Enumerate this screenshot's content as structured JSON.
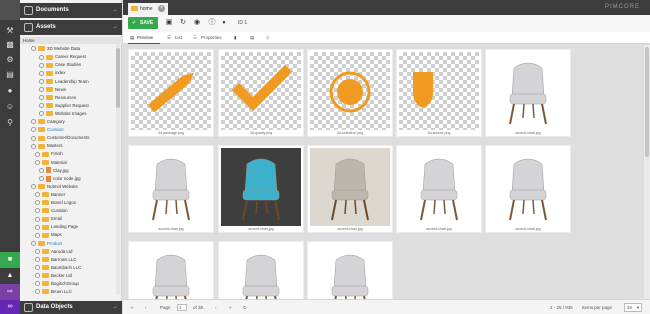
{
  "app": {
    "brand": "PIMCORE"
  },
  "panels": {
    "documents": "Documents",
    "assets": "Assets",
    "data_objects": "Data Objects"
  },
  "tree": {
    "items": [
      {
        "label": "Home",
        "kind": "home"
      },
      {
        "label": "3D Website Data",
        "kind": "folder"
      },
      {
        "label": "Career Request",
        "kind": "folder"
      },
      {
        "label": "Case Studies",
        "kind": "folder"
      },
      {
        "label": "index",
        "kind": "folder"
      },
      {
        "label": "Leadership Team",
        "kind": "folder"
      },
      {
        "label": "News",
        "kind": "folder"
      },
      {
        "label": "Resources",
        "kind": "folder"
      },
      {
        "label": "Supplier Request",
        "kind": "folder"
      },
      {
        "label": "Website Images",
        "kind": "folder"
      },
      {
        "label": "Category",
        "kind": "folder"
      },
      {
        "label": "Curation",
        "kind": "folder-link"
      },
      {
        "label": "Customer/Documents",
        "kind": "folder"
      },
      {
        "label": "Masters",
        "kind": "folder"
      },
      {
        "label": "Finish",
        "kind": "folder"
      },
      {
        "label": "Material",
        "kind": "folder"
      },
      {
        "label": "Clay.jpg",
        "kind": "image"
      },
      {
        "label": "color node.jpg",
        "kind": "image"
      },
      {
        "label": "Nutmol Website",
        "kind": "folder"
      },
      {
        "label": "Banner",
        "kind": "folder"
      },
      {
        "label": "Brand Logos",
        "kind": "folder"
      },
      {
        "label": "Curation",
        "kind": "folder"
      },
      {
        "label": "Email",
        "kind": "folder"
      },
      {
        "label": "Landing Page",
        "kind": "folder"
      },
      {
        "label": "Maps",
        "kind": "folder"
      },
      {
        "label": "Product",
        "kind": "folder-link"
      },
      {
        "label": "Aaroda Ltd",
        "kind": "folder"
      },
      {
        "label": "Barrows LLC",
        "kind": "folder"
      },
      {
        "label": "Baumbach LLC",
        "kind": "folder"
      },
      {
        "label": "Becker Ltd",
        "kind": "folder"
      },
      {
        "label": "BogischGroup",
        "kind": "folder"
      },
      {
        "label": "Bruen LLC",
        "kind": "folder"
      }
    ]
  },
  "tab": {
    "label": "home"
  },
  "toolbar": {
    "save_label": "SAVE",
    "id_label": "ID 1"
  },
  "subtabs": {
    "preview": "Preview",
    "list": "List",
    "properties": "Properties"
  },
  "grid": {
    "tiles": [
      {
        "caption": "3d-package.png",
        "kind": "pencil"
      },
      {
        "caption": "3d-quality.png",
        "kind": "check"
      },
      {
        "caption": "3d-selection.png",
        "kind": "circle"
      },
      {
        "caption": "3d-source.png",
        "kind": "shield"
      },
      {
        "caption": "accent-chair.jpg",
        "kind": "chair-white"
      },
      {
        "caption": "accent-chair.jpg",
        "kind": "chair-white"
      },
      {
        "caption": "accent-chair.jpg",
        "kind": "chair-blue"
      },
      {
        "caption": "accent-chair.jpg",
        "kind": "chair-room"
      },
      {
        "caption": "accent-chair.jpg",
        "kind": "chair-white"
      },
      {
        "caption": "accent-chair.jpg",
        "kind": "chair-white"
      },
      {
        "caption": "",
        "kind": "chair-white"
      },
      {
        "caption": "",
        "kind": "chair-white"
      },
      {
        "caption": "",
        "kind": "chair-white"
      }
    ]
  },
  "pager": {
    "page_label": "Page",
    "page": "1",
    "of_label": "of 38",
    "range": "1 - 25 / 935",
    "ipp_label": "Items per page",
    "ipp_value": "25"
  },
  "colors": {
    "accent": "#36a84d",
    "folder": "#f0b33c",
    "dark": "#3c3c3c"
  }
}
